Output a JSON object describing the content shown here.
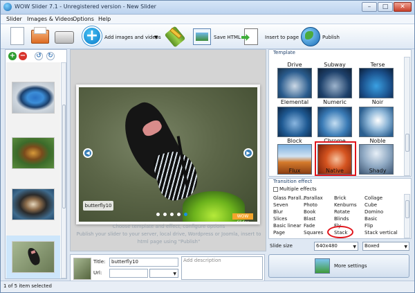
{
  "window": {
    "title": "WOW Slider 7.1 - Unregistered version - New Slider",
    "controls": {
      "minimize": "–",
      "maximize": "□",
      "close": "✕"
    }
  },
  "menu": [
    "Slider",
    "Images & Videos",
    "Options",
    "Help"
  ],
  "toolbar": {
    "add_images_label": "Add images and videos",
    "save_html_label": "Save HTML",
    "insert_label": "Insert to page",
    "publish_label": "Publish"
  },
  "left_panel": {
    "add_icon": "+",
    "remove_icon": "−"
  },
  "center": {
    "caption": "butterfly10",
    "logo": "WOW Slider",
    "hint_line1": "Choose template and effect, configure options",
    "hint_line2": "Publish your slider to your server, local drive, Wordpress or Joomla, insert to",
    "hint_line3": "html page using \"Publish\""
  },
  "properties": {
    "title_label": "Title:",
    "title_value": "butterfly10",
    "url_label": "Url:",
    "description_placeholder": "Add description"
  },
  "template": {
    "label": "Template",
    "row_labels_top": [
      "Drive",
      "Subway",
      "Terse"
    ],
    "row1": [
      "Elemental",
      "Numeric",
      "Noir"
    ],
    "row2": [
      "Block",
      "Chrome",
      "Noble"
    ],
    "row3": [
      "Flux",
      "Native",
      "Shady"
    ],
    "selected": "Native"
  },
  "transition": {
    "label": "Transition effect",
    "multiple_effects": "Multiple effects",
    "col1": [
      "Glass Parall...",
      "Seven",
      "Blur",
      "Slices",
      "Basic linear",
      "Page"
    ],
    "col2": [
      "Parallax",
      "Photo",
      "Book",
      "Blast",
      "Fade",
      "Squares"
    ],
    "col3": [
      "Brick",
      "Kenburns",
      "Rotate",
      "Blinds",
      "Fly",
      "Stack"
    ],
    "col4": [
      "Collage",
      "Cube",
      "Domino",
      "Basic",
      "Flip",
      "Stack vertical"
    ],
    "selected": "Stack"
  },
  "slide_size": {
    "label": "Slide size",
    "value": "640x480",
    "mode": "Boxed"
  },
  "more_settings": "More settings",
  "status": "1 of 5 item selected",
  "colors": {
    "accent": "#1b8fe0",
    "highlight": "#e0141b"
  }
}
